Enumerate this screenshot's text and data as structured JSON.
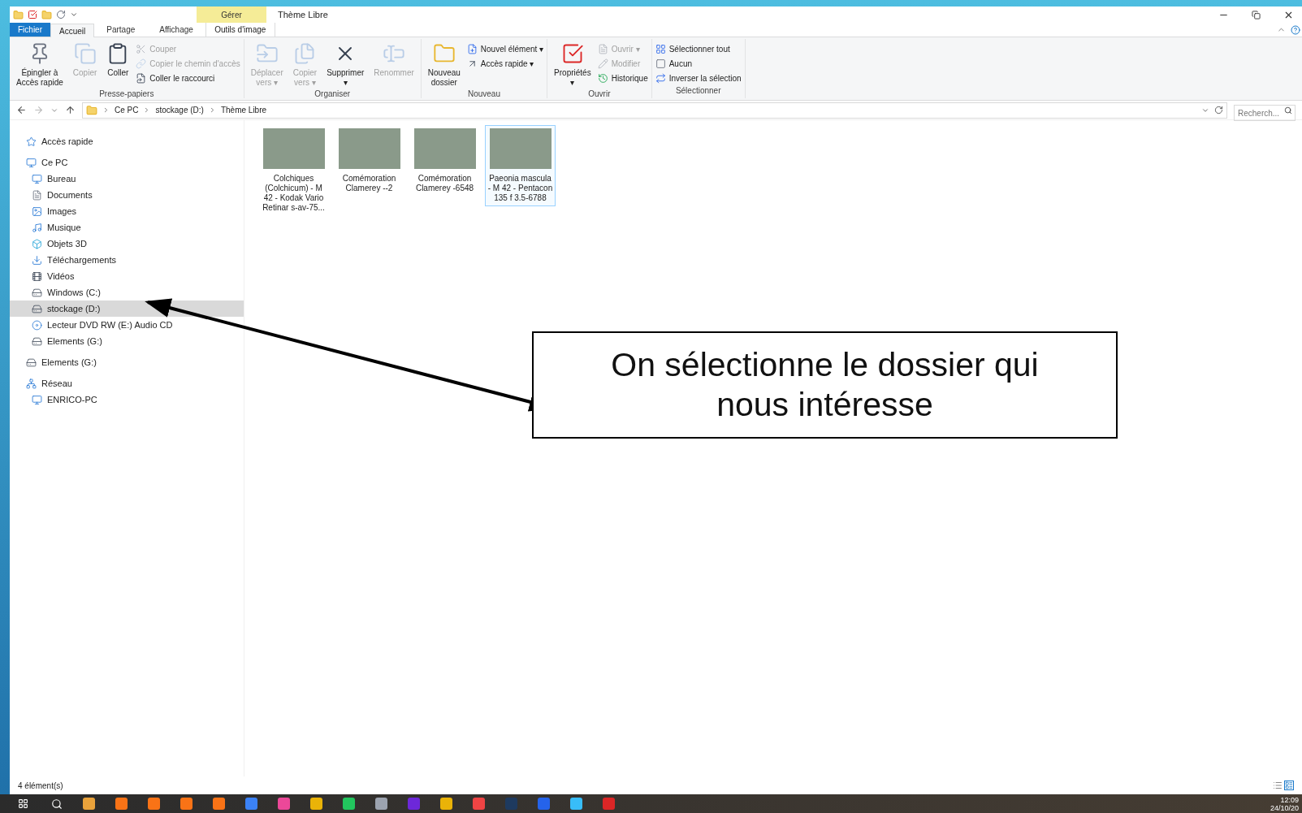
{
  "window": {
    "title": "Thème Libre",
    "context_tab": "Gérer"
  },
  "tabs": [
    {
      "label": "Fichier",
      "kind": "file",
      "selected": false
    },
    {
      "label": "Accueil",
      "kind": "tab",
      "selected": true
    },
    {
      "label": "Partage",
      "kind": "tab",
      "selected": false
    },
    {
      "label": "Affichage",
      "kind": "tab",
      "selected": false
    },
    {
      "label": "Outils d'image",
      "kind": "context",
      "selected": false
    }
  ],
  "ribbon": {
    "groups": [
      {
        "label": "Presse-papiers",
        "items": [
          {
            "kind": "large",
            "label": "Épingler à\nAccès rapide",
            "disabled": false
          },
          {
            "kind": "large",
            "label": "Copier",
            "disabled": true
          },
          {
            "kind": "large",
            "label": "Coller",
            "disabled": false
          },
          {
            "kind": "stack",
            "items": [
              {
                "label": "Couper",
                "disabled": true
              },
              {
                "label": "Copier le chemin d'accès",
                "disabled": true
              },
              {
                "label": "Coller le raccourci",
                "disabled": false
              }
            ]
          }
        ]
      },
      {
        "label": "Organiser",
        "items": [
          {
            "kind": "large",
            "label": "Déplacer\nvers ▾",
            "disabled": true
          },
          {
            "kind": "large",
            "label": "Copier\nvers ▾",
            "disabled": true
          },
          {
            "kind": "large",
            "label": "Supprimer\n▾",
            "disabled": false
          },
          {
            "kind": "large",
            "label": "Renommer",
            "disabled": true
          }
        ]
      },
      {
        "label": "Nouveau",
        "items": [
          {
            "kind": "large",
            "label": "Nouveau\ndossier",
            "disabled": false
          },
          {
            "kind": "stack",
            "items": [
              {
                "label": "Nouvel élément ▾",
                "disabled": false
              },
              {
                "label": "Accès rapide ▾",
                "disabled": false
              }
            ]
          }
        ]
      },
      {
        "label": "Ouvrir",
        "items": [
          {
            "kind": "large",
            "label": "Propriétés\n▾",
            "disabled": false
          },
          {
            "kind": "stack",
            "items": [
              {
                "label": "Ouvrir ▾",
                "disabled": true
              },
              {
                "label": "Modifier",
                "disabled": true
              },
              {
                "label": "Historique",
                "disabled": false
              }
            ]
          }
        ]
      },
      {
        "label": "Sélectionner",
        "items": [
          {
            "kind": "stack",
            "items": [
              {
                "label": "Sélectionner tout",
                "disabled": false
              },
              {
                "label": "Aucun",
                "disabled": false
              },
              {
                "label": "Inverser la sélection",
                "disabled": false
              }
            ]
          }
        ]
      }
    ]
  },
  "address": {
    "path": [
      "Ce PC",
      "stockage (D:)",
      "Thème Libre"
    ],
    "search_placeholder": "Recherch..."
  },
  "navigation": [
    {
      "label": "Accès rapide",
      "kind": "star",
      "selected": false
    },
    {
      "label": "Ce PC",
      "kind": "pc",
      "selected": false,
      "children": [
        {
          "label": "Bureau",
          "kind": "desktop",
          "selected": false
        },
        {
          "label": "Documents",
          "kind": "doc",
          "selected": false
        },
        {
          "label": "Images",
          "kind": "images",
          "selected": false
        },
        {
          "label": "Musique",
          "kind": "music",
          "selected": false
        },
        {
          "label": "Objets 3D",
          "kind": "cube",
          "selected": false
        },
        {
          "label": "Téléchargements",
          "kind": "download",
          "selected": false
        },
        {
          "label": "Vidéos",
          "kind": "video",
          "selected": false
        },
        {
          "label": "Windows (C:)",
          "kind": "drive",
          "selected": false
        },
        {
          "label": "stockage (D:)",
          "kind": "drive",
          "selected": true
        },
        {
          "label": "Lecteur DVD RW (E:) Audio CD",
          "kind": "cd",
          "selected": false
        },
        {
          "label": "Elements (G:)",
          "kind": "drive",
          "selected": false
        }
      ]
    },
    {
      "label": "Elements (G:)",
      "kind": "drive",
      "selected": false
    },
    {
      "label": "Réseau",
      "kind": "network",
      "selected": false,
      "children": [
        {
          "label": "ENRICO-PC",
          "kind": "pc",
          "selected": false
        }
      ]
    }
  ],
  "files": [
    {
      "name": "Colchiques (Colchicum) - M 42 - Kodak Vario Retinar s-av-75...",
      "selected": false
    },
    {
      "name": "Comémoration Clamerey --2",
      "selected": false
    },
    {
      "name": "Comémoration Clamerey -6548",
      "selected": false
    },
    {
      "name": "Paeonia mascula - M 42 - Pentacon 135 f 3.5-6788",
      "selected": true
    }
  ],
  "status_bar": {
    "count": "4 élément(s)"
  },
  "taskbar": {
    "time": "12:09",
    "date": "24/10/20"
  },
  "annotation": {
    "text": "On sélectionne le dossier qui nous intéresse"
  }
}
